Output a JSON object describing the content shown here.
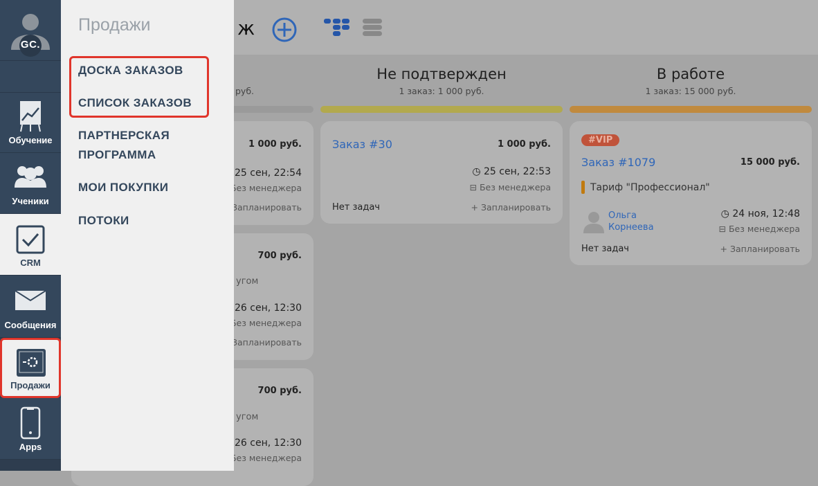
{
  "nav": {
    "avatar_text": "GC.",
    "items": [
      {
        "label": "Обучение",
        "icon": "chart-board-icon"
      },
      {
        "label": "Ученики",
        "icon": "users-icon"
      },
      {
        "label": "CRM",
        "icon": "checkbox-icon"
      },
      {
        "label": "Сообщения",
        "icon": "envelope-icon"
      },
      {
        "label": "Продажи",
        "icon": "safe-icon"
      },
      {
        "label": "Apps",
        "icon": "phone-icon"
      }
    ]
  },
  "panel": {
    "title": "Продажи",
    "items": [
      "ДОСКА ЗАКАЗОВ",
      "СПИСОК ЗАКАЗОВ",
      "ПАРТНЕРСКАЯ ПРОГРАММА",
      "МОИ ПОКУПКИ",
      "ПОТОКИ"
    ]
  },
  "header": {
    "title_fragment": "ж"
  },
  "columns": [
    {
      "subtitle_fragment": "руб.",
      "bar_color": "#9a9a9a",
      "cards": [
        {
          "price": "1 000 руб.",
          "date": "25 сен, 22:54",
          "manager": "Без менеджера",
          "schedule": "Запланировать"
        },
        {
          "price": "700 руб.",
          "note": "угом",
          "date": "26 сен, 12:30",
          "manager": "Без менеджера",
          "schedule": "Запланировать"
        },
        {
          "price": "700 руб.",
          "note": "угом",
          "date": "26 сен, 12:30",
          "manager": "Без менеджера"
        }
      ]
    },
    {
      "title": "Не подтвержден",
      "subtitle": "1 заказ: 1 000 руб.",
      "bar_color": "#b2a94e",
      "cards": [
        {
          "order": "Заказ #30",
          "price": "1 000 руб.",
          "date": "25 сен, 22:53",
          "manager": "Без менеджера",
          "tasks": "Нет задач",
          "schedule": "+ Запланировать"
        }
      ]
    },
    {
      "title": "В работе",
      "subtitle": "1 заказ: 15 000 руб.",
      "bar_color": "#c08a3e",
      "cards": [
        {
          "tag": "#VIP",
          "order": "Заказ #1079",
          "price": "15 000 руб.",
          "tariff": "Тариф \"Профессионал\"",
          "client": "Ольга Корнеева",
          "date": "24 ноя, 12:48",
          "manager": "Без менеджера",
          "tasks": "Нет задач",
          "schedule": "+ Запланировать"
        }
      ]
    }
  ]
}
